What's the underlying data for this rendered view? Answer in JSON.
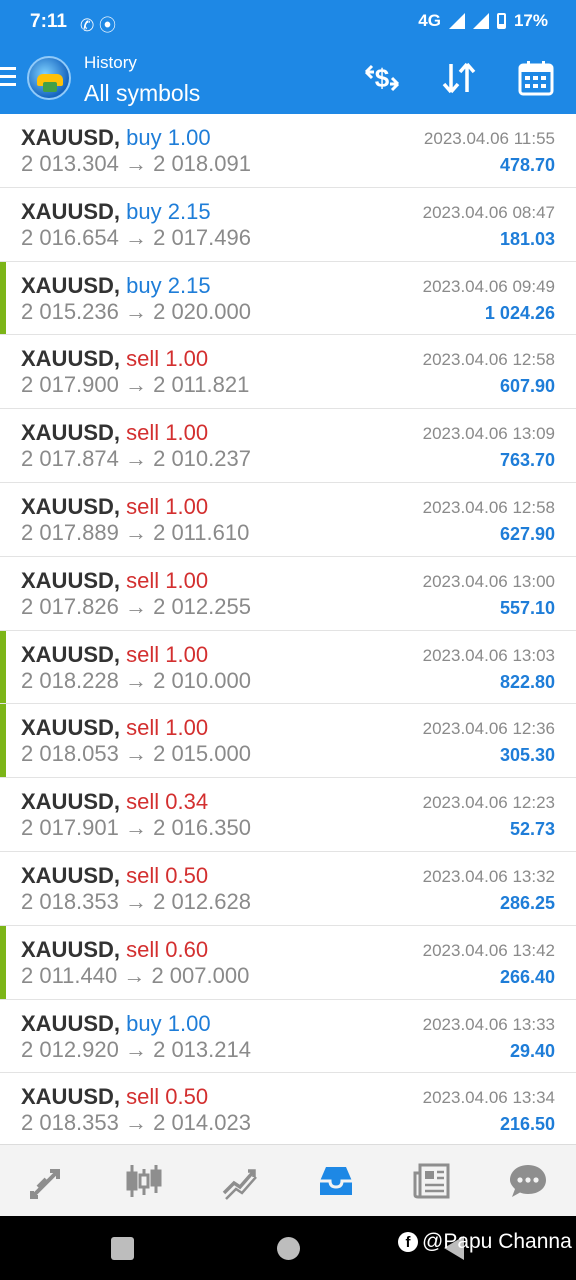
{
  "status": {
    "time": "7:11",
    "network": "4G",
    "battery": "17%"
  },
  "appbar": {
    "subtitle": "History",
    "title": "All symbols"
  },
  "trades": [
    {
      "symbol": "XAUUSD,",
      "side": "buy",
      "volume": "1.00",
      "prices": "2 013.304 → 2 018.091",
      "datetime": "2023.04.06 11:55",
      "profit": "478.70",
      "marked": false
    },
    {
      "symbol": "XAUUSD,",
      "side": "buy",
      "volume": "2.15",
      "prices": "2 016.654 → 2 017.496",
      "datetime": "2023.04.06 08:47",
      "profit": "181.03",
      "marked": false
    },
    {
      "symbol": "XAUUSD,",
      "side": "buy",
      "volume": "2.15",
      "prices": "2 015.236 → 2 020.000",
      "datetime": "2023.04.06 09:49",
      "profit": "1 024.26",
      "marked": true
    },
    {
      "symbol": "XAUUSD,",
      "side": "sell",
      "volume": "1.00",
      "prices": "2 017.900 → 2 011.821",
      "datetime": "2023.04.06 12:58",
      "profit": "607.90",
      "marked": false
    },
    {
      "symbol": "XAUUSD,",
      "side": "sell",
      "volume": "1.00",
      "prices": "2 017.874 → 2 010.237",
      "datetime": "2023.04.06 13:09",
      "profit": "763.70",
      "marked": false
    },
    {
      "symbol": "XAUUSD,",
      "side": "sell",
      "volume": "1.00",
      "prices": "2 017.889 → 2 011.610",
      "datetime": "2023.04.06 12:58",
      "profit": "627.90",
      "marked": false
    },
    {
      "symbol": "XAUUSD,",
      "side": "sell",
      "volume": "1.00",
      "prices": "2 017.826 → 2 012.255",
      "datetime": "2023.04.06 13:00",
      "profit": "557.10",
      "marked": false
    },
    {
      "symbol": "XAUUSD,",
      "side": "sell",
      "volume": "1.00",
      "prices": "2 018.228 → 2 010.000",
      "datetime": "2023.04.06 13:03",
      "profit": "822.80",
      "marked": true
    },
    {
      "symbol": "XAUUSD,",
      "side": "sell",
      "volume": "1.00",
      "prices": "2 018.053 → 2 015.000",
      "datetime": "2023.04.06 12:36",
      "profit": "305.30",
      "marked": true
    },
    {
      "symbol": "XAUUSD,",
      "side": "sell",
      "volume": "0.34",
      "prices": "2 017.901 → 2 016.350",
      "datetime": "2023.04.06 12:23",
      "profit": "52.73",
      "marked": false
    },
    {
      "symbol": "XAUUSD,",
      "side": "sell",
      "volume": "0.50",
      "prices": "2 018.353 → 2 012.628",
      "datetime": "2023.04.06 13:32",
      "profit": "286.25",
      "marked": false
    },
    {
      "symbol": "XAUUSD,",
      "side": "sell",
      "volume": "0.60",
      "prices": "2 011.440 → 2 007.000",
      "datetime": "2023.04.06 13:42",
      "profit": "266.40",
      "marked": true
    },
    {
      "symbol": "XAUUSD,",
      "side": "buy",
      "volume": "1.00",
      "prices": "2 012.920 → 2 013.214",
      "datetime": "2023.04.06 13:33",
      "profit": "29.40",
      "marked": false
    },
    {
      "symbol": "XAUUSD,",
      "side": "sell",
      "volume": "0.50",
      "prices": "2 018.353 → 2 014.023",
      "datetime": "2023.04.06 13:34",
      "profit": "216.50",
      "marked": false
    }
  ],
  "tabs": [
    {
      "name": "tab-quotes",
      "icon": "quotes-arrows-icon",
      "active": false
    },
    {
      "name": "tab-chart",
      "icon": "candlestick-chart-icon",
      "active": false
    },
    {
      "name": "tab-trade",
      "icon": "trade-trend-icon",
      "active": false
    },
    {
      "name": "tab-history",
      "icon": "inbox-tray-icon",
      "active": true
    },
    {
      "name": "tab-news",
      "icon": "newspaper-icon",
      "active": false
    },
    {
      "name": "tab-messages",
      "icon": "chat-bubble-icon",
      "active": false
    }
  ],
  "colors": {
    "header": "#1e88e5",
    "buy": "#1e7dd8",
    "sell": "#d32f2f",
    "marker": "#7cb518",
    "profit": "#1e7dd8"
  },
  "watermark": "@Papu Channa"
}
